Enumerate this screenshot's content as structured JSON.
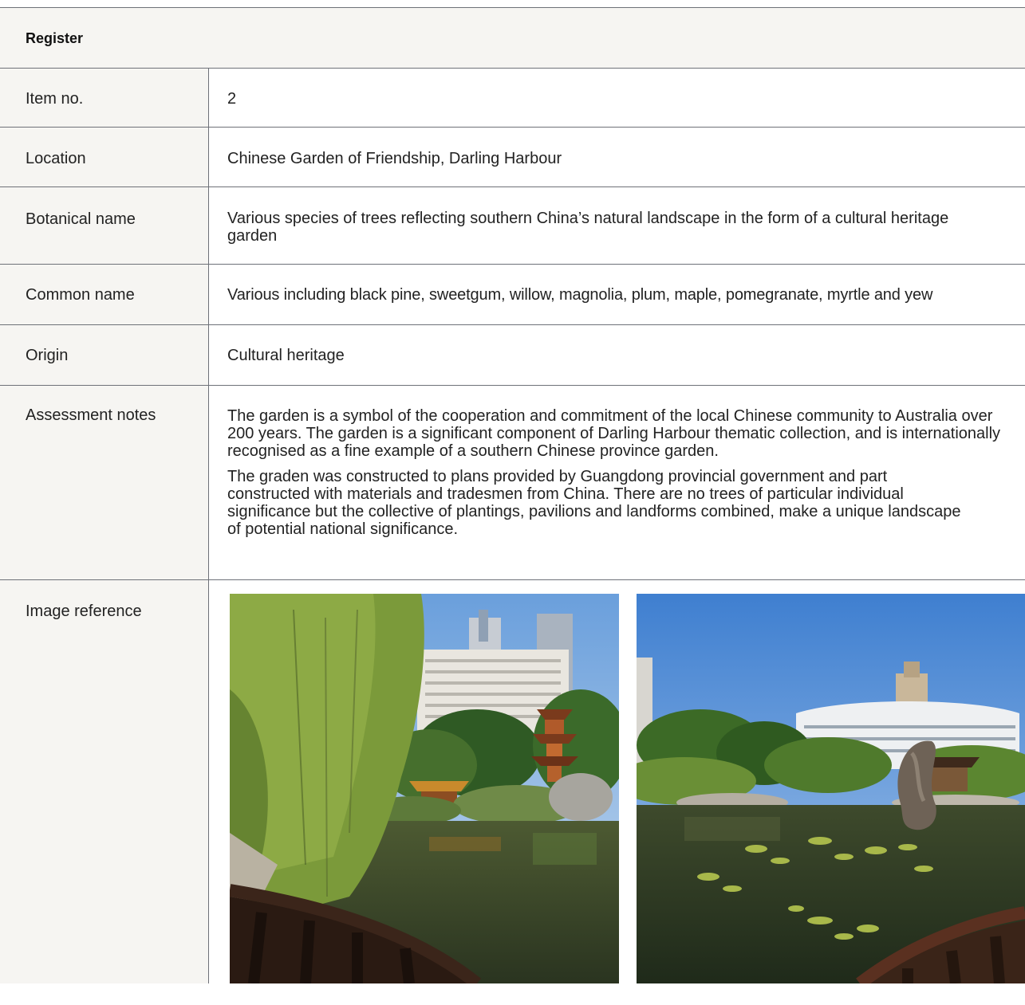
{
  "register": {
    "title": "Register",
    "rows": [
      {
        "label": "Item no.",
        "value": "2"
      },
      {
        "label": "Location",
        "value": "Chinese Garden of Friendship, Darling Harbour"
      },
      {
        "label": "Botanical name",
        "value": "Various species of trees reflecting southern China’s natural landscape in the form of a cultural heritage garden"
      },
      {
        "label": "Common name",
        "value": "Various including black pine, sweetgum, willow, magnolia, plum, maple, pomegranate, myrtle and yew"
      },
      {
        "label": "Origin",
        "value": "Cultural heritage"
      },
      {
        "label": "Assessment notes",
        "paragraphs": [
          "The garden is a symbol of the cooperation and commitment of the local Chinese community to Australia over 200 years. The garden is a significant component of Darling Harbour thematic collection, and is internationally recognised as a fine example of a southern Chinese province garden.",
          "The graden was constructed to plans provided by Guangdong provincial government and part constructed with materials and tradesmen from China. There are no trees of particular individual significance but the collective of plantings, pavilions and landforms combined, make a unique landscape of potential national significance."
        ]
      },
      {
        "label": "Image reference"
      }
    ]
  },
  "images": [
    {
      "subject": "garden-pond-with-willow-and-pagoda"
    },
    {
      "subject": "garden-pond-with-rock-and-water-lilies"
    }
  ]
}
